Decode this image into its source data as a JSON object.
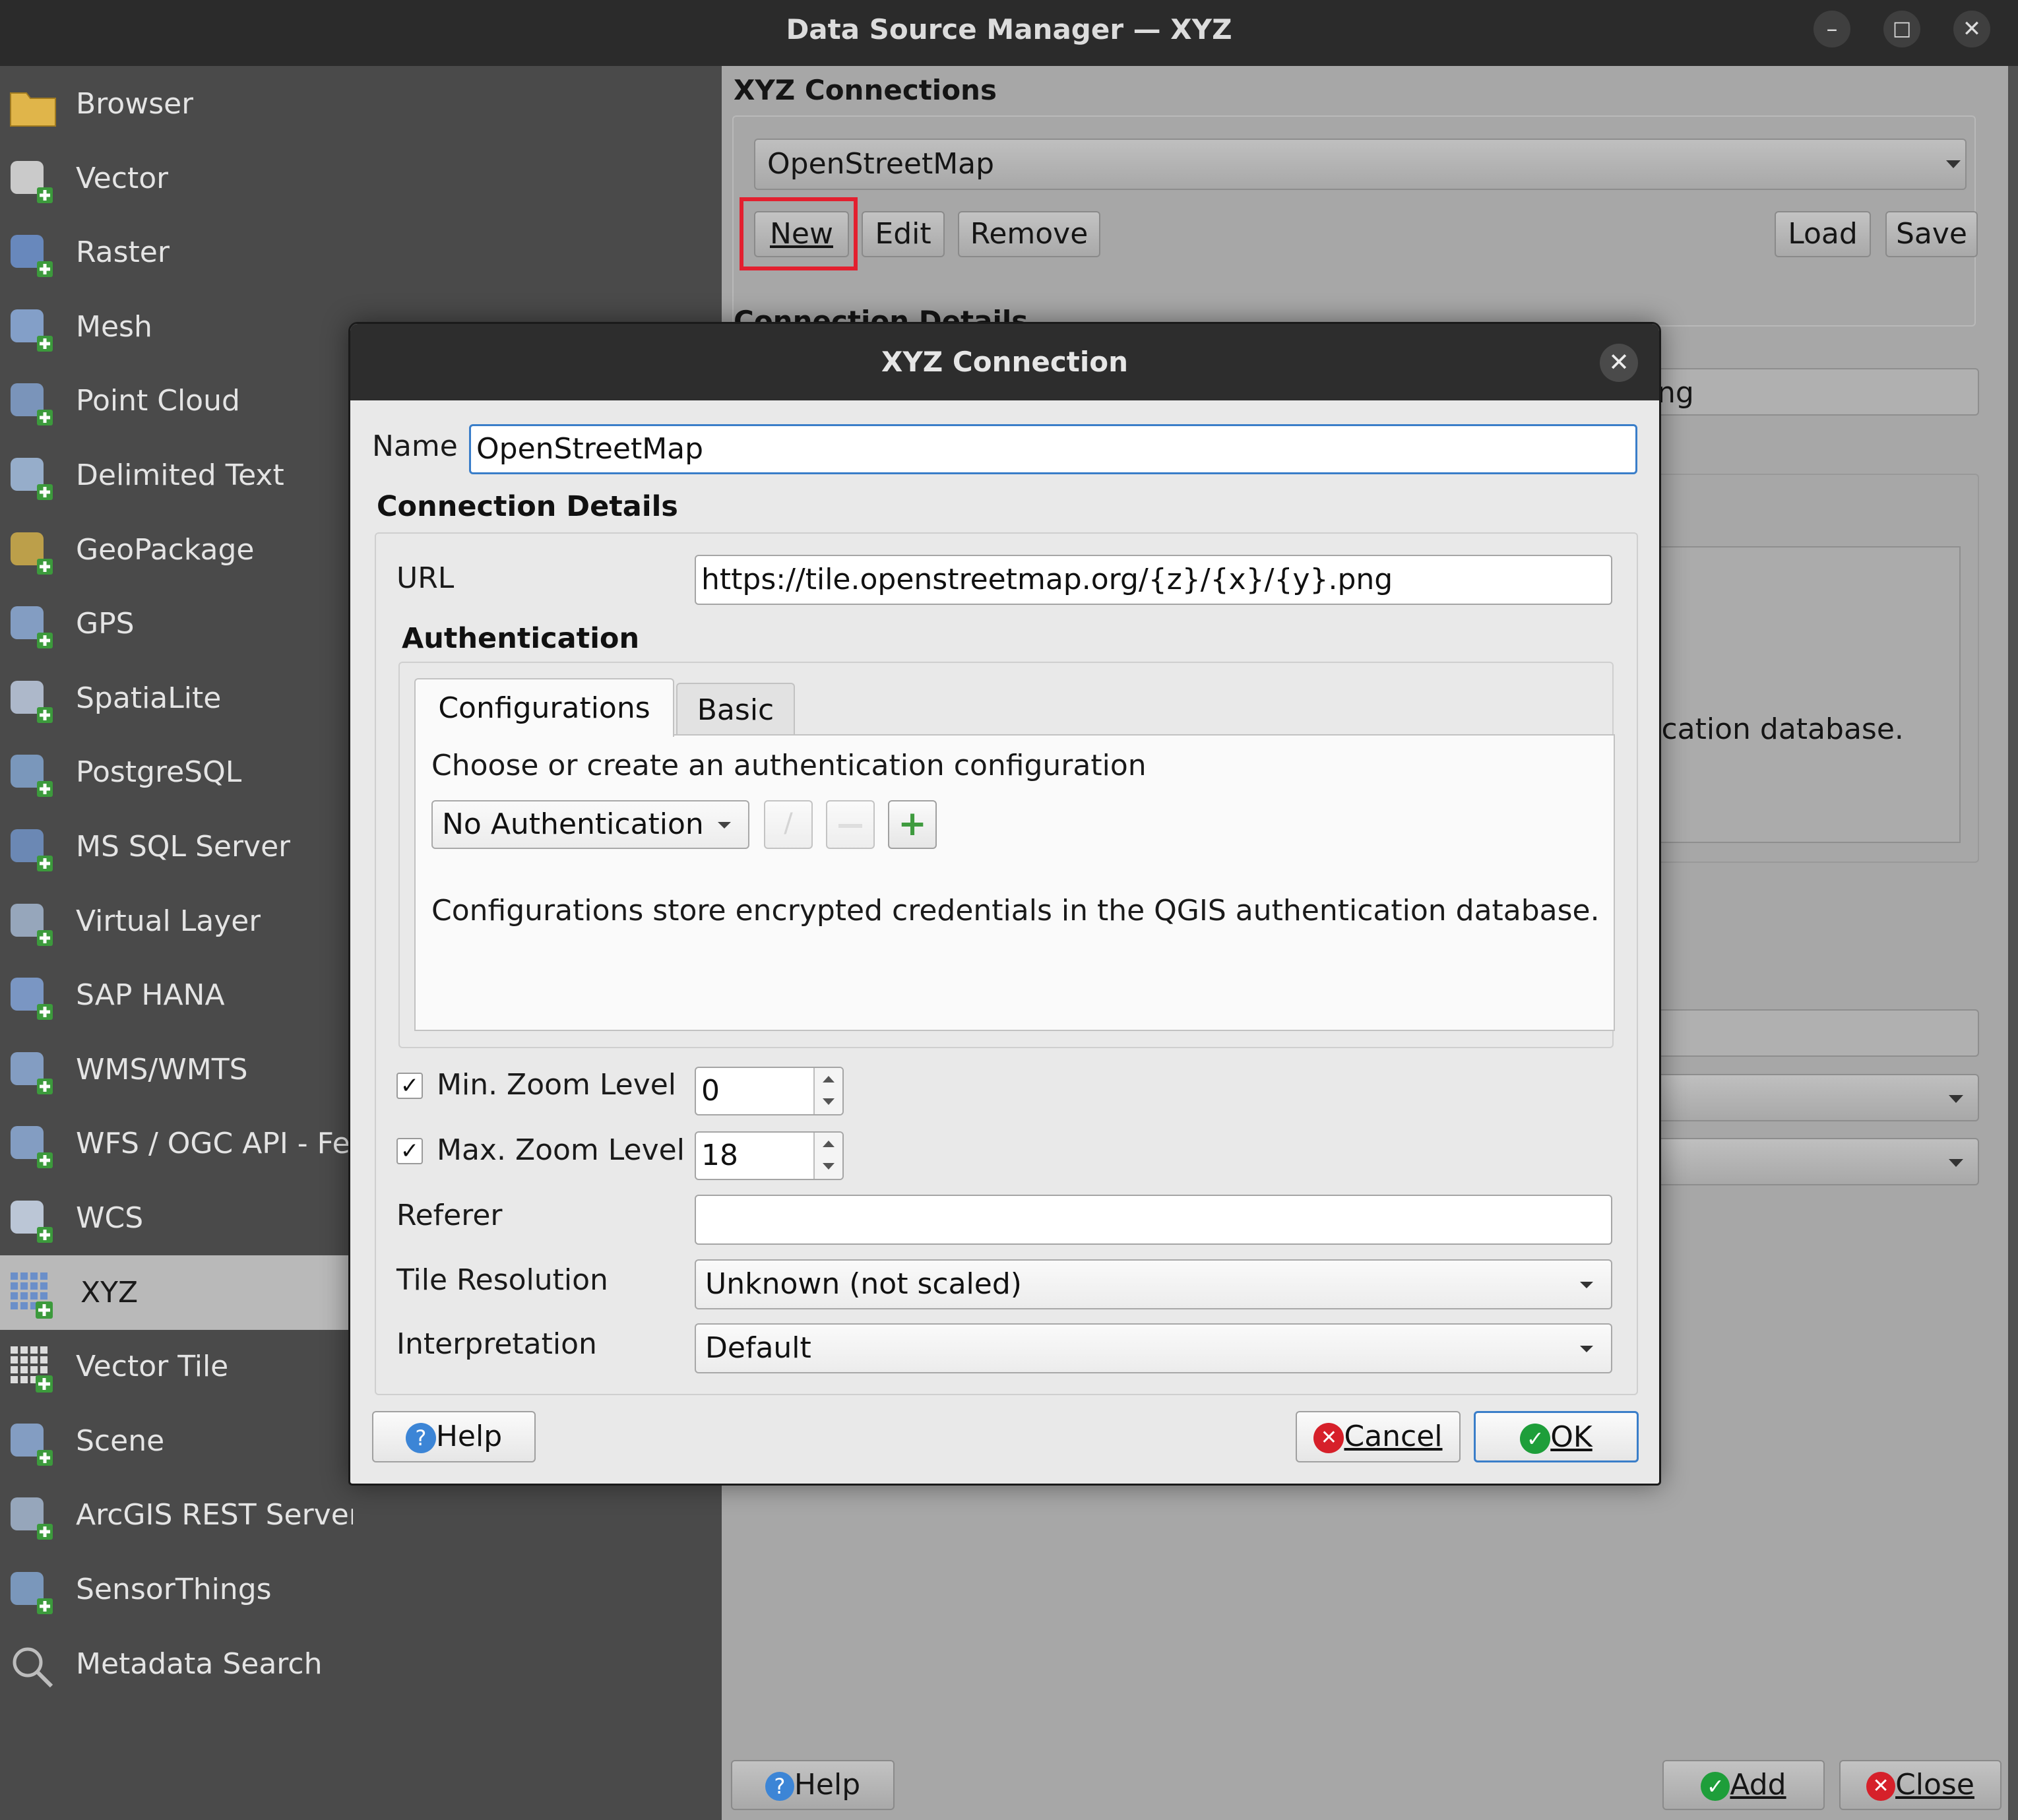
{
  "window": {
    "title": "Data Source Manager — XYZ",
    "minimize": "–",
    "maximize": "□",
    "close": "✕"
  },
  "sidebar": {
    "items": [
      {
        "label": "Browser",
        "icon": "folder-icon"
      },
      {
        "label": "Vector",
        "icon": "vector-icon"
      },
      {
        "label": "Raster",
        "icon": "raster-icon"
      },
      {
        "label": "Mesh",
        "icon": "mesh-icon"
      },
      {
        "label": "Point Cloud",
        "icon": "point-cloud-icon"
      },
      {
        "label": "Delimited Text",
        "icon": "delimited-text-icon"
      },
      {
        "label": "GeoPackage",
        "icon": "geopackage-icon"
      },
      {
        "label": "GPS",
        "icon": "gps-icon"
      },
      {
        "label": "SpatiaLite",
        "icon": "spatialite-icon"
      },
      {
        "label": "PostgreSQL",
        "icon": "postgresql-icon"
      },
      {
        "label": "MS SQL Server",
        "icon": "mssql-icon"
      },
      {
        "label": "Virtual Layer",
        "icon": "virtual-layer-icon"
      },
      {
        "label": "SAP HANA",
        "icon": "sap-hana-icon"
      },
      {
        "label": "WMS/WMTS",
        "icon": "wms-icon"
      },
      {
        "label": "WFS / OGC API - Fea",
        "icon": "wfs-icon"
      },
      {
        "label": "WCS",
        "icon": "wcs-icon"
      },
      {
        "label": "XYZ",
        "icon": "xyz-icon",
        "selected": true
      },
      {
        "label": "Vector Tile",
        "icon": "vector-tile-icon"
      },
      {
        "label": "Scene",
        "icon": "scene-icon"
      },
      {
        "label": "ArcGIS REST Server",
        "icon": "arcgis-icon"
      },
      {
        "label": "SensorThings",
        "icon": "sensorthings-icon"
      },
      {
        "label": "Metadata Search",
        "icon": "search-icon"
      }
    ]
  },
  "panel": {
    "section_title": "XYZ Connections",
    "connection_selected": "OpenStreetMap",
    "buttons": {
      "new": "New",
      "edit": "Edit",
      "remove": "Remove",
      "load": "Load",
      "save": "Save"
    },
    "partial_section_title": "Connection Details",
    "partial_field_text": "ng",
    "partial_text": "tication database.",
    "footer": {
      "help": "Help",
      "add": "Add",
      "close": "Close"
    }
  },
  "dialog": {
    "title": "XYZ Connection",
    "close_icon": "✕",
    "name_label": "Name",
    "name_value": "OpenStreetMap",
    "connection_details_title": "Connection Details",
    "url_label": "URL",
    "url_value": "https://tile.openstreetmap.org/{z}/{x}/{y}.png",
    "auth_title": "Authentication",
    "tabs": [
      "Configurations",
      "Basic"
    ],
    "auth_prompt": "Choose or create an authentication configuration",
    "auth_selected": "No Authentication",
    "auth_note": "Configurations store encrypted credentials in the QGIS authentication database.",
    "min_zoom_label": "Min. Zoom Level",
    "min_zoom_checked": true,
    "min_zoom_value": "0",
    "max_zoom_label": "Max. Zoom Level",
    "max_zoom_checked": true,
    "max_zoom_value": "18",
    "referer_label": "Referer",
    "referer_value": "",
    "tile_resolution_label": "Tile Resolution",
    "tile_resolution_value": "Unknown (not scaled)",
    "interpretation_label": "Interpretation",
    "interpretation_value": "Default",
    "buttons": {
      "help": "Help",
      "cancel": "Cancel",
      "ok": "OK"
    }
  },
  "colors": {
    "highlight": "#e3202f",
    "focus": "#3a7ec9",
    "ok_green": "#1e9e3a",
    "cancel_red": "#d6202a",
    "help_blue": "#3c85d6"
  }
}
